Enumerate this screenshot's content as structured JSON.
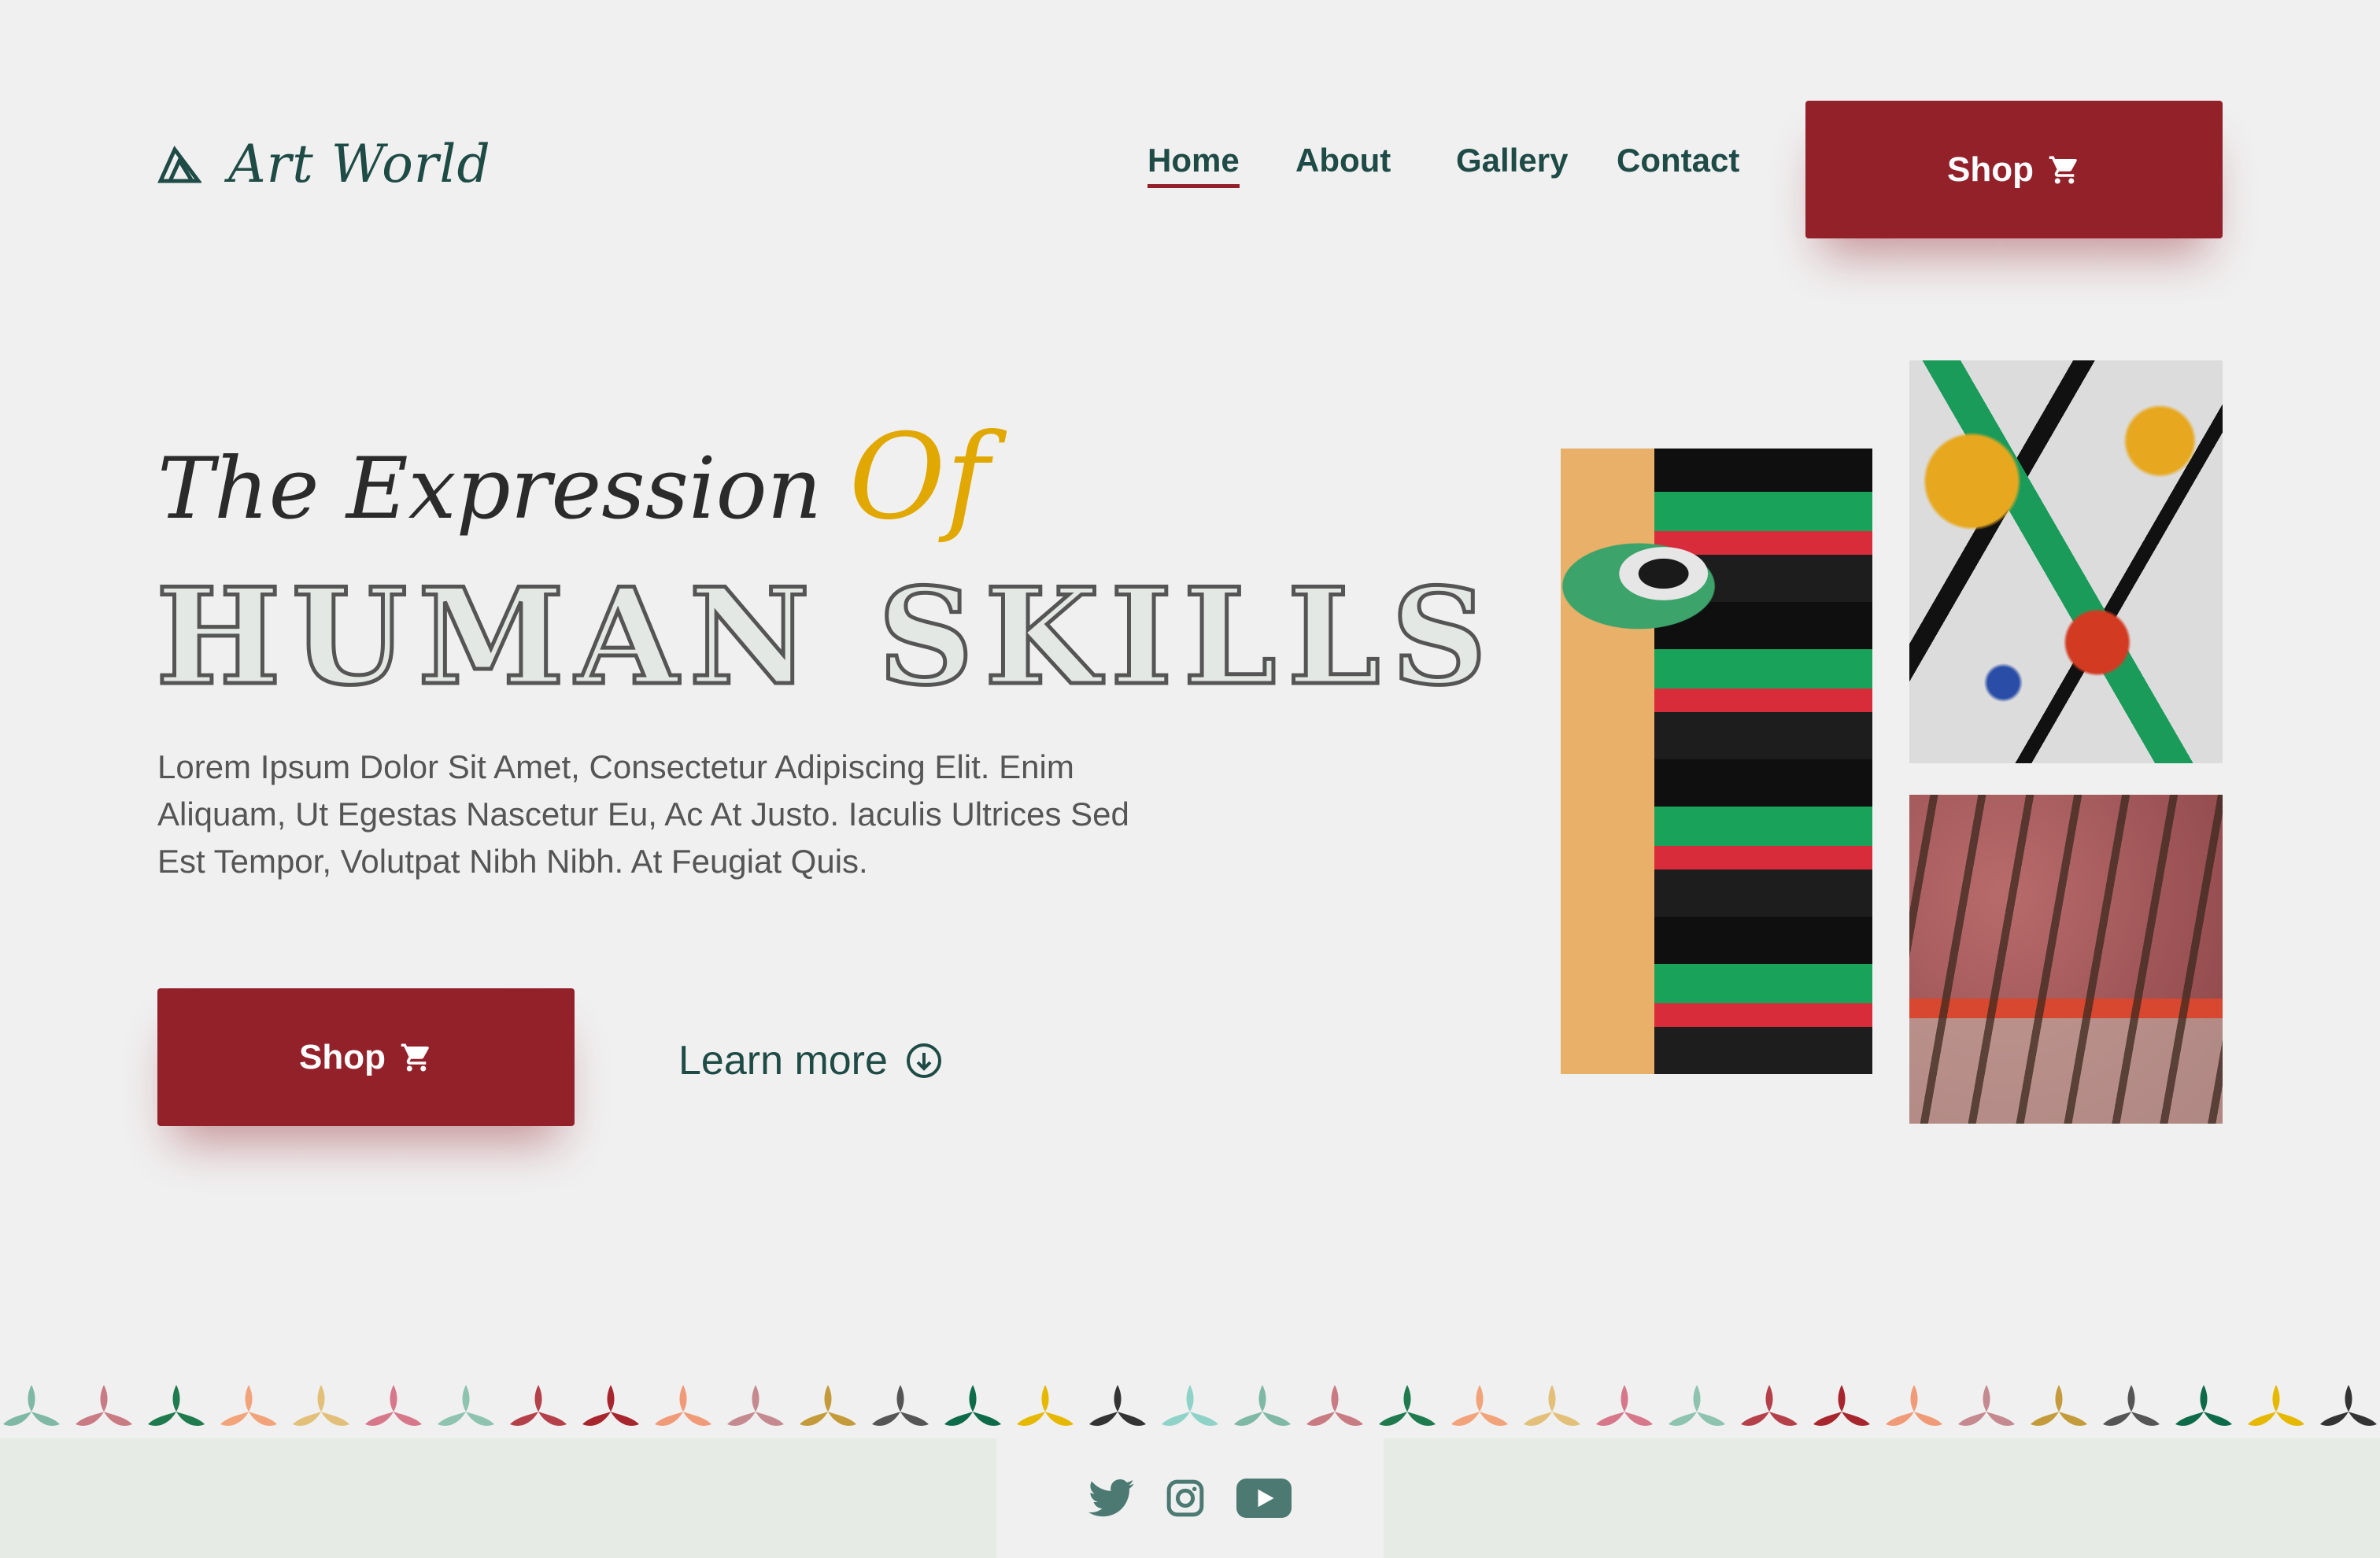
{
  "brand": {
    "name": "Art World",
    "icon": "logo-triangles-icon"
  },
  "nav": {
    "items": [
      {
        "label": "Home",
        "active": true
      },
      {
        "label": "About",
        "active": false
      },
      {
        "label": "Gallery",
        "active": false
      },
      {
        "label": "Contact",
        "active": false
      }
    ],
    "shop_label": "Shop",
    "shop_icon": "cart-icon"
  },
  "hero": {
    "tagline": "The Expression",
    "tagline_accent": "Of",
    "headline": "HUMAN SKILLS",
    "description": "Lorem Ipsum Dolor Sit Amet, Consectetur Adipiscing Elit. Enim Aliquam, Ut Egestas Nascetur Eu, Ac At Justo. Iaculis Ultrices Sed Est Tempor, Volutpat Nibh Nibh. At Feugiat Quis.",
    "shop_label": "Shop",
    "learn_more": "Learn more",
    "learn_more_icon": "arrow-down-circle-icon"
  },
  "gallery": {
    "images": [
      "street-mural-image",
      "paint-splash-image",
      "paint-brushes-image"
    ]
  },
  "footer": {
    "socials": [
      "twitter-icon",
      "instagram-icon",
      "youtube-icon"
    ]
  },
  "colors": {
    "primary": "#93212a",
    "text_dark": "#1e4b45",
    "accent": "#e0a800",
    "background": "#f0f0f0",
    "footer_bg": "#e6ebe6"
  }
}
